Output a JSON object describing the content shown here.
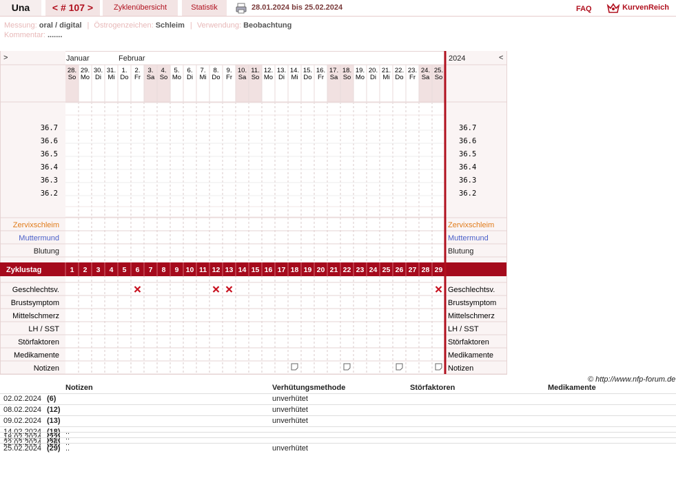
{
  "topbar": {
    "user": "Una",
    "cycle": "< # 107 >",
    "overview": "Zyklenübersicht",
    "stats": "Statistik",
    "range": "28.01.2024 bis 25.02.2024",
    "faq": "FAQ",
    "logo": "KurvenReich"
  },
  "meta": {
    "messung_label": "Messung:",
    "messung": "oral / digital",
    "oestrogen_label": "Östrogenzeichen:",
    "oestrogen": "Schleim",
    "verwendung_label": "Verwendung:",
    "verwendung": "Beobachtung",
    "kommentar_label": "Kommentar:",
    "kommentar": "......."
  },
  "chart": {
    "nav_prev": ">",
    "nav_next": "<",
    "year": "2024",
    "months": [
      "Januar",
      "Februar"
    ],
    "days": [
      {
        "d": "28.",
        "w": "So",
        "we": true
      },
      {
        "d": "29.",
        "w": "Mo",
        "we": false
      },
      {
        "d": "30.",
        "w": "Di",
        "we": false
      },
      {
        "d": "31.",
        "w": "Mi",
        "we": false
      },
      {
        "d": "1.",
        "w": "Do",
        "we": false
      },
      {
        "d": "2.",
        "w": "Fr",
        "we": false
      },
      {
        "d": "3.",
        "w": "Sa",
        "we": true
      },
      {
        "d": "4.",
        "w": "So",
        "we": true
      },
      {
        "d": "5.",
        "w": "Mo",
        "we": false
      },
      {
        "d": "6.",
        "w": "Di",
        "we": false
      },
      {
        "d": "7.",
        "w": "Mi",
        "we": false
      },
      {
        "d": "8.",
        "w": "Do",
        "we": false
      },
      {
        "d": "9.",
        "w": "Fr",
        "we": false
      },
      {
        "d": "10.",
        "w": "Sa",
        "we": true
      },
      {
        "d": "11.",
        "w": "So",
        "we": true
      },
      {
        "d": "12.",
        "w": "Mo",
        "we": false
      },
      {
        "d": "13.",
        "w": "Di",
        "we": false
      },
      {
        "d": "14.",
        "w": "Mi",
        "we": false
      },
      {
        "d": "15.",
        "w": "Do",
        "we": false
      },
      {
        "d": "16.",
        "w": "Fr",
        "we": false
      },
      {
        "d": "17.",
        "w": "Sa",
        "we": true
      },
      {
        "d": "18.",
        "w": "So",
        "we": true
      },
      {
        "d": "19.",
        "w": "Mo",
        "we": false
      },
      {
        "d": "20.",
        "w": "Di",
        "we": false
      },
      {
        "d": "21.",
        "w": "Mi",
        "we": false
      },
      {
        "d": "22.",
        "w": "Do",
        "we": false
      },
      {
        "d": "23.",
        "w": "Fr",
        "we": false
      },
      {
        "d": "24.",
        "w": "Sa",
        "we": true
      },
      {
        "d": "25.",
        "w": "So",
        "we": true
      }
    ],
    "temps": [
      "36.7",
      "36.6",
      "36.5",
      "36.4",
      "36.3",
      "36.2"
    ],
    "rows_top": [
      {
        "label": "Zervixschleim",
        "color": "#e07b1a"
      },
      {
        "label": "Muttermund",
        "color": "#4a5fc8"
      },
      {
        "label": "Blutung",
        "color": "#222222"
      }
    ],
    "cycle_label": "Zyklustag",
    "cycle_days": [
      "1",
      "2",
      "3",
      "4",
      "5",
      "6",
      "7",
      "8",
      "9",
      "10",
      "11",
      "12",
      "13",
      "14",
      "15",
      "16",
      "17",
      "18",
      "19",
      "20",
      "21",
      "22",
      "23",
      "24",
      "25",
      "26",
      "27",
      "28",
      "29"
    ],
    "rows_bottom": [
      "Geschlechtsv.",
      "Brustsymptom",
      "Mittelschmerz",
      "LH / SST",
      "Störfaktoren",
      "Medikamente",
      "Notizen"
    ],
    "intercourse_days": [
      6,
      12,
      13,
      29
    ],
    "note_days": [
      18,
      22,
      26,
      29
    ],
    "colors": {
      "accent": "#b0101e",
      "cycle_bar": "#a50a1c",
      "weekend": "#f1e1e1",
      "grid": "#e6d3d3"
    }
  },
  "footer_url": "© http://www.nfp-forum.de",
  "notes": {
    "headers": [
      "Notizen",
      "Verhütungsmethode",
      "Störfaktoren",
      "Medikamente"
    ],
    "rows": [
      {
        "date": "02.02.2024",
        "day": "(6)",
        "note": "",
        "method": "unverhütet"
      },
      {
        "date": "08.02.2024",
        "day": "(12)",
        "note": "",
        "method": "unverhütet"
      },
      {
        "date": "09.02.2024",
        "day": "(13)",
        "note": "",
        "method": "unverhütet"
      },
      {
        "date": "14.02.2024",
        "day": "(18)",
        "note": "..",
        "method": ""
      },
      {
        "date": "18.02.2024",
        "day": "(22)",
        "note": "..",
        "method": ""
      },
      {
        "date": "22.02.2024",
        "day": "(26)",
        "note": "..",
        "method": ""
      },
      {
        "date": "25.02.2024",
        "day": "(29)",
        "note": "..",
        "method": "unverhütet"
      }
    ]
  }
}
